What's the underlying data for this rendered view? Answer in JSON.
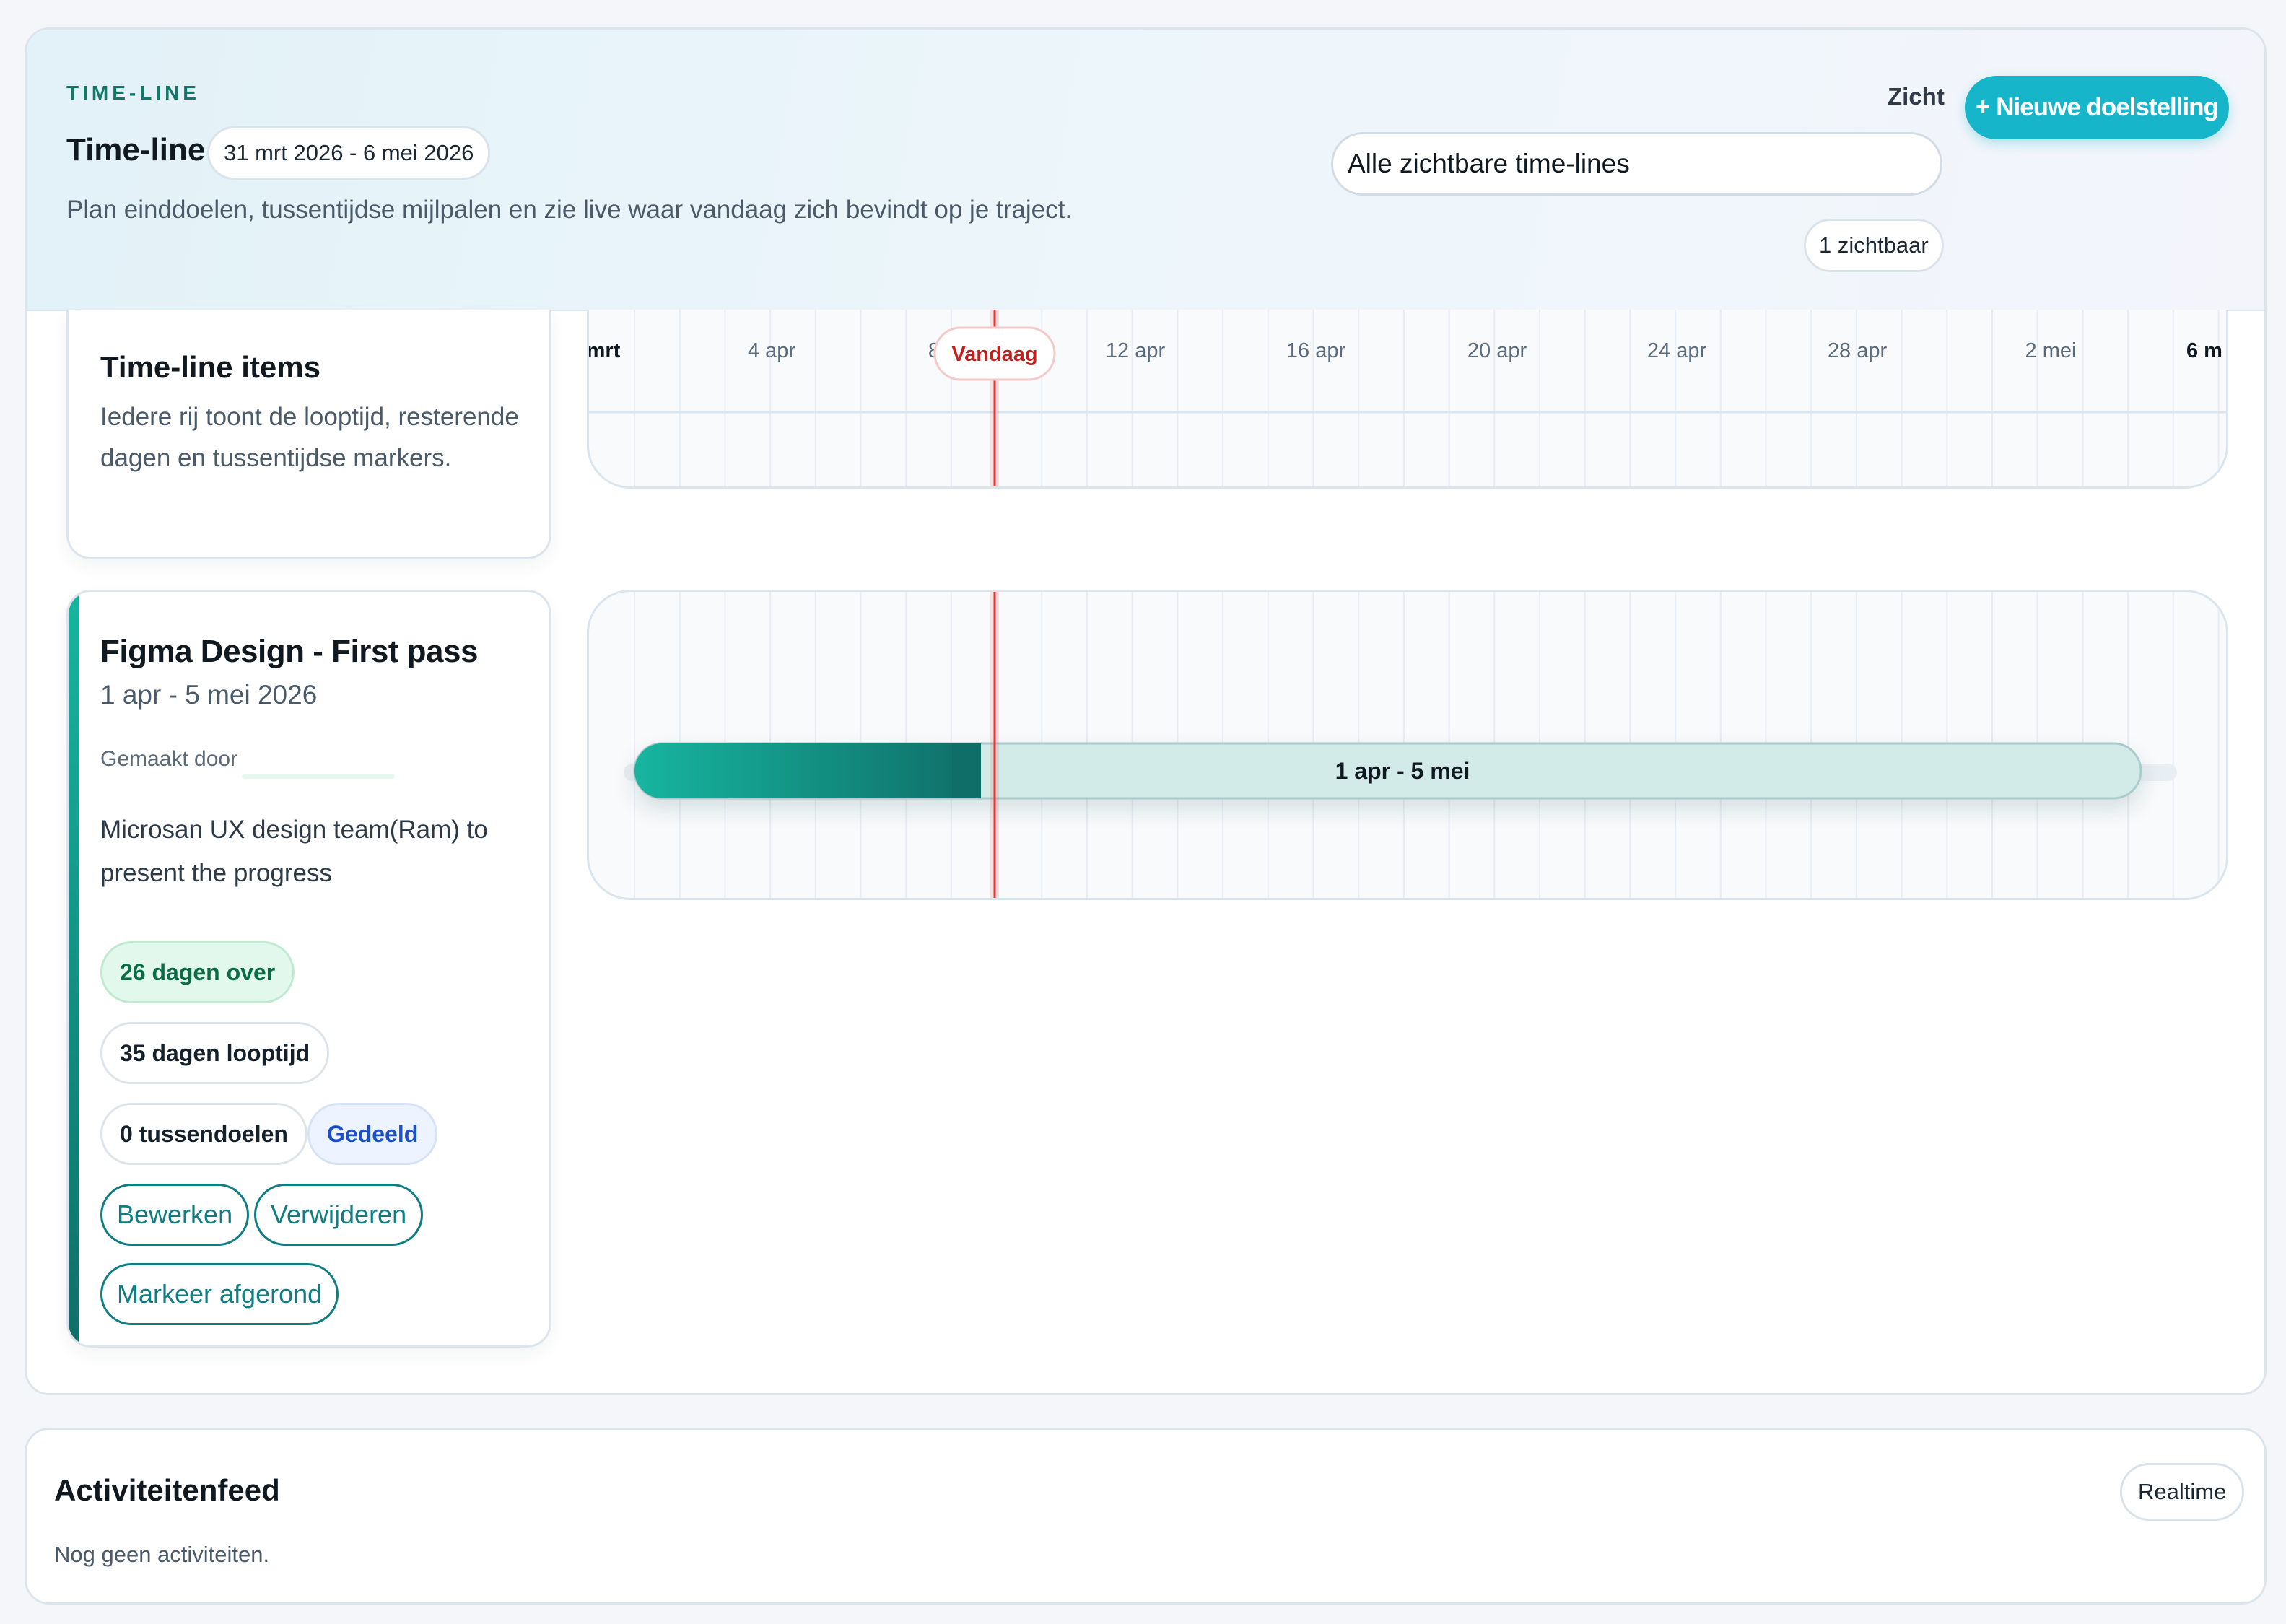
{
  "header": {
    "eyebrow": "TIME-LINE",
    "title": "Time-line",
    "range_chip": "31 mrt 2026 - 6 mei 2026",
    "subtitle": "Plan einddoelen, tussentijdse mijlpalen en zie live waar vandaag zich bevindt op je traject.",
    "view_label": "Zicht",
    "new_goal_button": "+ Nieuwe doelstelling",
    "filter_value": "Alle zichtbare time-lines",
    "visible_badge": "1 zichtbaar"
  },
  "info_card": {
    "title": "Time-line items",
    "description": "Iedere rij toont de looptijd, resterende dagen en tussentijdse markers."
  },
  "timeline": {
    "today_label": "Vandaag",
    "today_color": "#e53935",
    "ticks": [
      "mrt",
      "4 apr",
      "8",
      "12 apr",
      "16 apr",
      "20 apr",
      "24 apr",
      "28 apr",
      "2 mei",
      "6 m"
    ]
  },
  "goal": {
    "title": "Figma Design - First pass",
    "date_range": "1 apr - 5 mei 2026",
    "created_by_label": "Gemaakt door",
    "description": "Microsan UX design team(Ram) to present the progress",
    "days_left": "26 dagen over",
    "duration": "35 dagen looptijd",
    "milestones": "0 tussendoelen",
    "shared": "Gedeeld",
    "bar_label": "1 apr - 5 mei",
    "progress": 0.23,
    "actions": {
      "edit": "Bewerken",
      "delete": "Verwijderen",
      "complete": "Markeer afgerond"
    }
  },
  "feed": {
    "title": "Activiteitenfeed",
    "empty": "Nog geen activiteiten.",
    "badge": "Realtime"
  },
  "colors": {
    "accent": "#17b5c9",
    "teal_dark": "#0f6e67",
    "today": "#e53935"
  }
}
